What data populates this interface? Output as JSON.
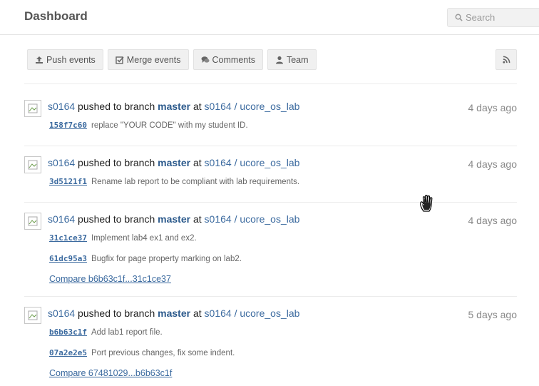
{
  "header": {
    "title": "Dashboard",
    "search_placeholder": "Search"
  },
  "filters": [
    {
      "label": "Push events",
      "icon": "upload-icon"
    },
    {
      "label": "Merge events",
      "icon": "checkbox-icon"
    },
    {
      "label": "Comments",
      "icon": "comments-icon"
    },
    {
      "label": "Team",
      "icon": "user-icon"
    }
  ],
  "rss_icon": "rss-icon",
  "events": [
    {
      "user": "s0164",
      "action": "pushed to branch",
      "branch": "master",
      "at": "at",
      "repo": "s0164 / ucore_os_lab",
      "time": "4 days ago",
      "commits": [
        {
          "sha": "158f7c60",
          "message": "replace \"YOUR CODE\" with my student ID."
        }
      ]
    },
    {
      "user": "s0164",
      "action": "pushed to branch",
      "branch": "master",
      "at": "at",
      "repo": "s0164 / ucore_os_lab",
      "time": "4 days ago",
      "commits": [
        {
          "sha": "3d5121f1",
          "message": "Rename lab report to be compliant with lab requirements."
        }
      ]
    },
    {
      "user": "s0164",
      "action": "pushed to branch",
      "branch": "master",
      "at": "at",
      "repo": "s0164 / ucore_os_lab",
      "time": "4 days ago",
      "commits": [
        {
          "sha": "31c1ce37",
          "message": "Implement lab4 ex1 and ex2."
        },
        {
          "sha": "61dc95a3",
          "message": "Bugfix for page property marking on lab2."
        }
      ],
      "compare": "Compare b6b63c1f...31c1ce37"
    },
    {
      "user": "s0164",
      "action": "pushed to branch",
      "branch": "master",
      "at": "at",
      "repo": "s0164 / ucore_os_lab",
      "time": "5 days ago",
      "commits": [
        {
          "sha": "b6b63c1f",
          "message": "Add lab1 report file."
        },
        {
          "sha": "07a2e2e5",
          "message": "Port previous changes, fix some indent."
        }
      ],
      "compare": "Compare 67481029...b6b63c1f"
    }
  ],
  "colors": {
    "link": "#3b6a9f",
    "branch": "#2c5a8c",
    "button_bg": "#f0f0f0",
    "muted": "#888888"
  }
}
